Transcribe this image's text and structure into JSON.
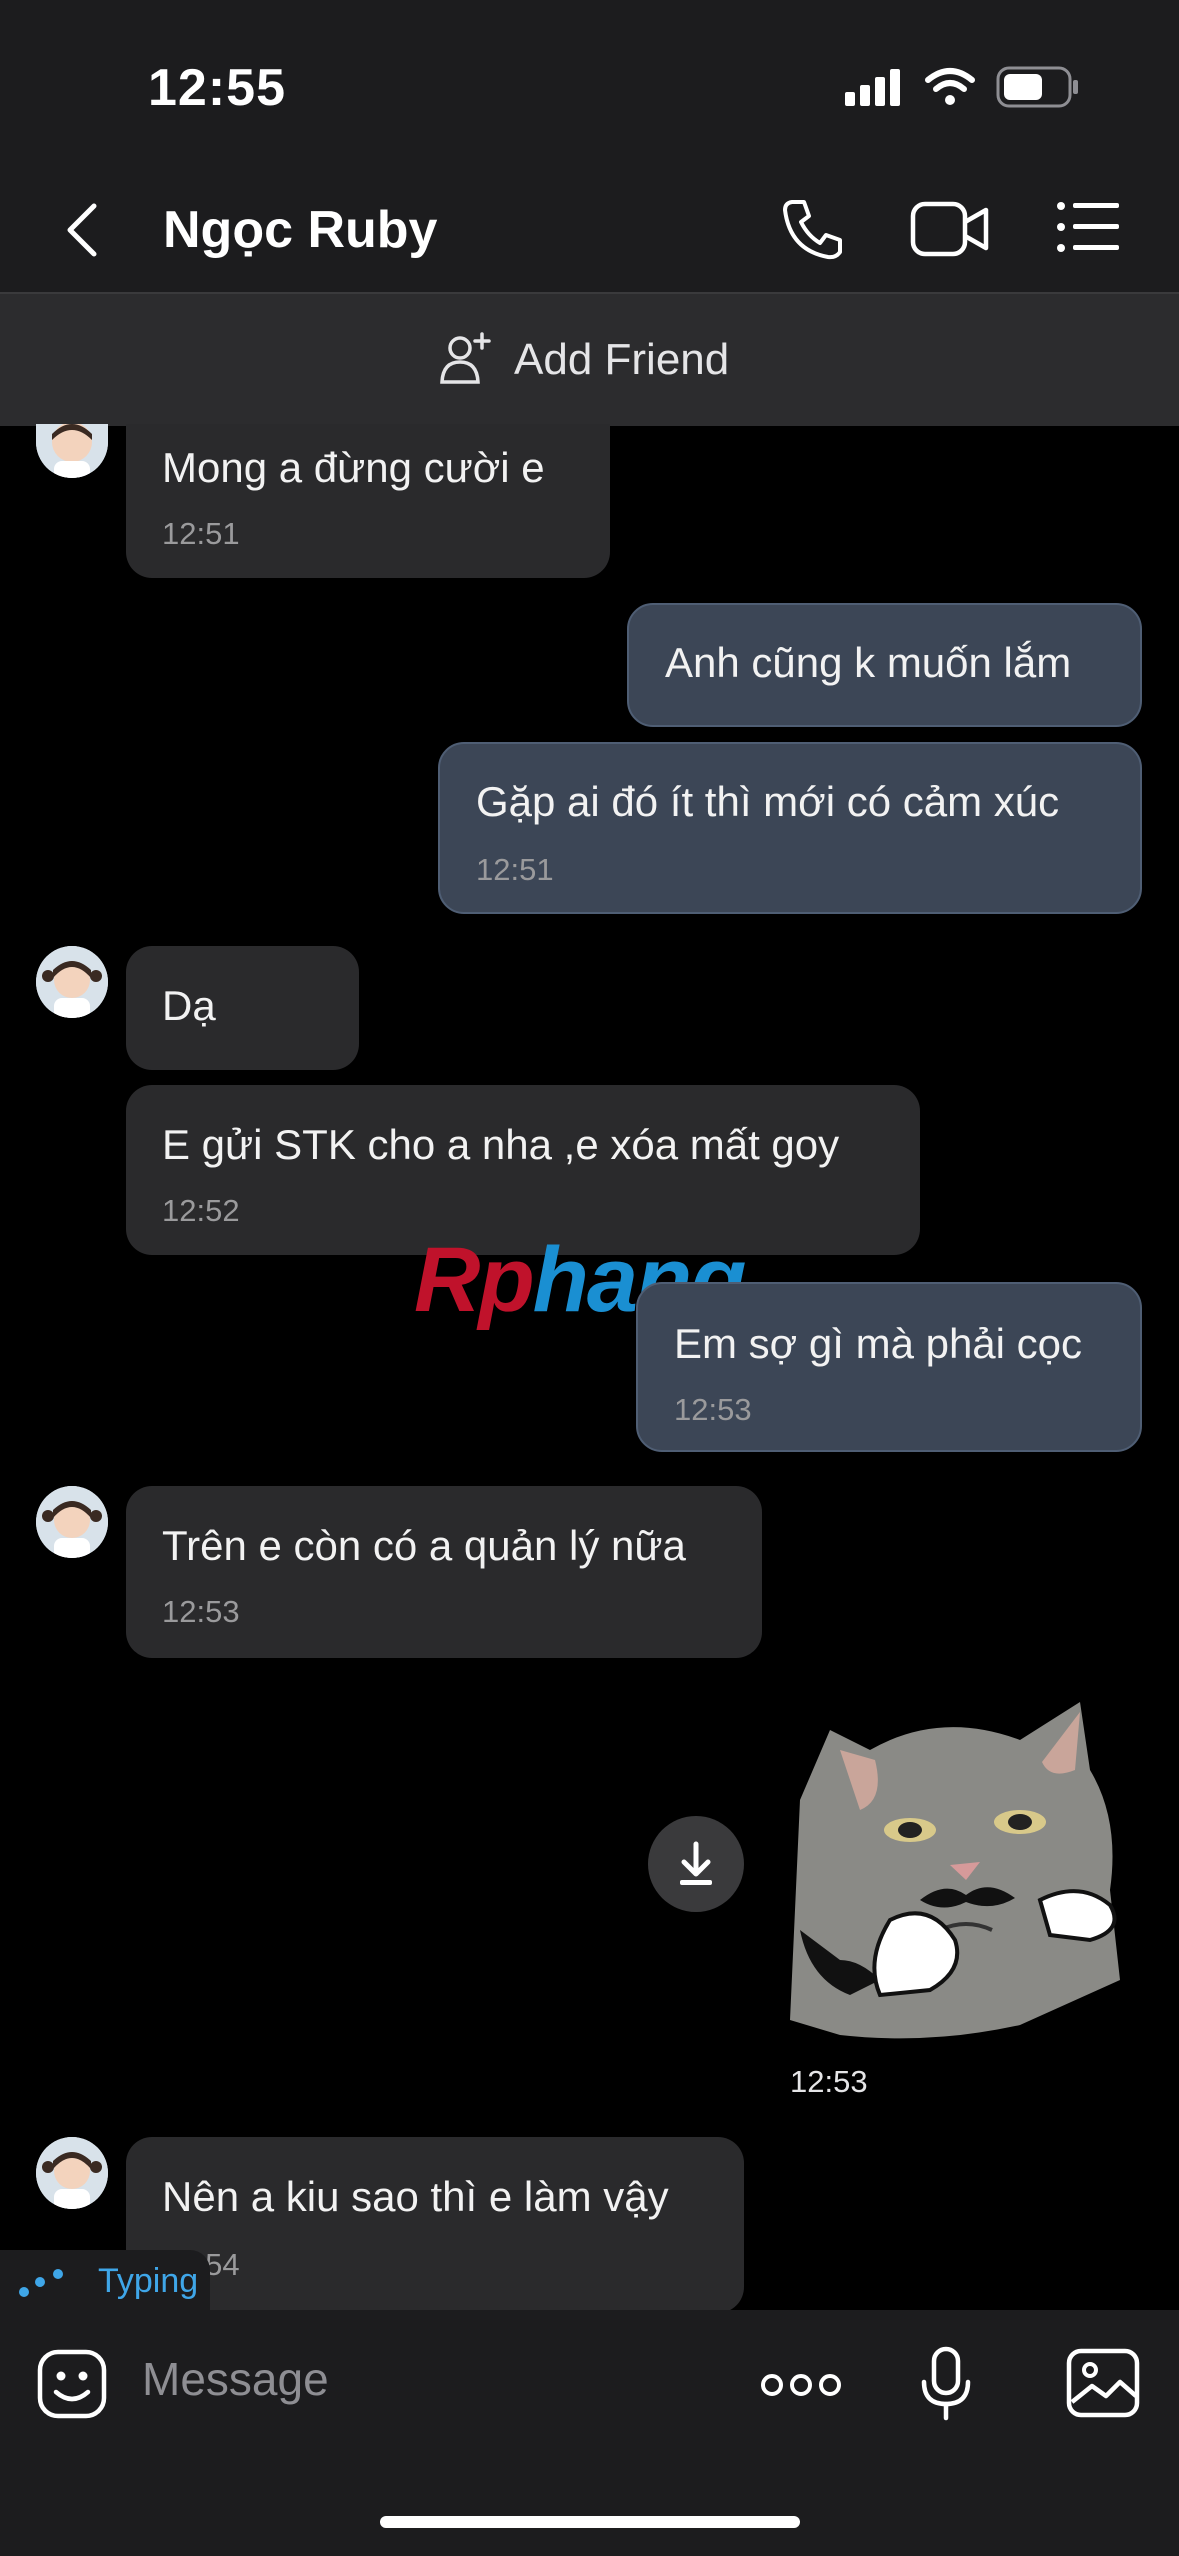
{
  "status_bar": {
    "time": "12:55"
  },
  "header": {
    "title": "Ngọc Ruby",
    "add_friend": "Add Friend"
  },
  "messages": {
    "m1": {
      "text": "Mong a đừng cười e",
      "time": "12:51"
    },
    "m2": {
      "text": "Anh cũng k muốn lắm"
    },
    "m3": {
      "text": "Gặp ai đó ít thì mới có cảm xúc",
      "time": "12:51"
    },
    "m4": {
      "text": "Dạ"
    },
    "m5": {
      "text": "E gửi STK cho a nha ,e xóa mất goy",
      "time": "12:52"
    },
    "m6": {
      "text": "Em sợ gì mà phải cọc",
      "time": "12:53"
    },
    "m7": {
      "text": "Trên e còn có a quản lý nữa",
      "time": "12:53"
    },
    "sticker": {
      "time": "12:53"
    },
    "m8": {
      "text": "Nên a kiu sao thì e làm vậy",
      "time": "12:54"
    }
  },
  "typing_indicator": "Typing",
  "watermark": {
    "part1": "Rp",
    "part2": "hang"
  },
  "composer": {
    "placeholder": "Message"
  },
  "colors": {
    "incoming_bubble": "#2a2a2c",
    "outgoing_bubble": "#3c4656",
    "accent": "#3fa6e8"
  }
}
